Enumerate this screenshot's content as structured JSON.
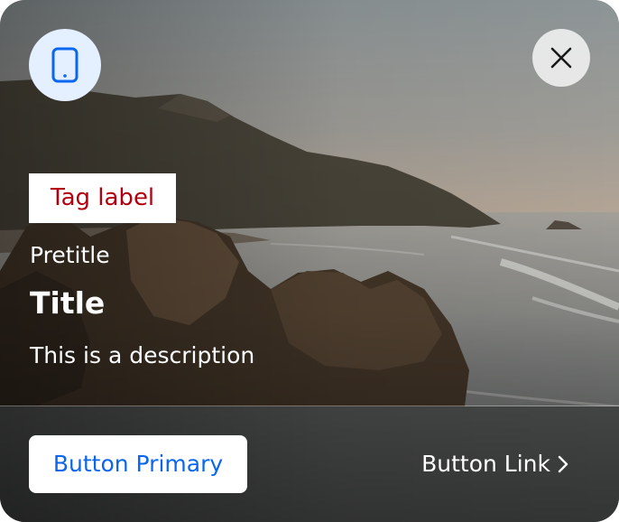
{
  "card": {
    "tag_label": "Tag label",
    "pretitle": "Pretitle",
    "title": "Title",
    "description": "This is a description"
  },
  "actions": {
    "primary_label": "Button Primary",
    "link_label": "Button Link"
  },
  "icons": {
    "badge": "mobile-phone-icon",
    "close": "close-icon",
    "link_chevron": "chevron-right-icon"
  },
  "colors": {
    "accent": "#0b66ee",
    "tag_text": "#b3000f",
    "icon_badge_bg": "#e4efff"
  }
}
